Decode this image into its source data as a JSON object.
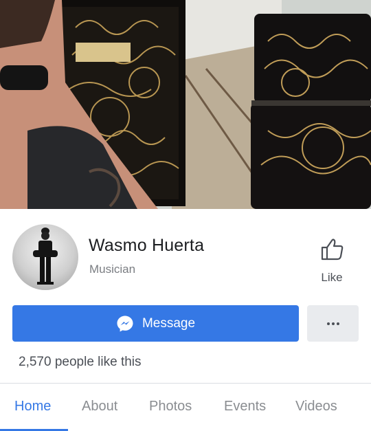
{
  "profile": {
    "name": "Wasmo Huerta",
    "category": "Musician",
    "likes_count_text": "2,570 people like this"
  },
  "actions": {
    "like_label": "Like",
    "message_label": "Message",
    "more_icon": "more-dots-icon"
  },
  "tabs": [
    {
      "label": "Home",
      "active": true
    },
    {
      "label": "About",
      "active": false
    },
    {
      "label": "Photos",
      "active": false
    },
    {
      "label": "Events",
      "active": false
    },
    {
      "label": "Videos",
      "active": false
    }
  ],
  "colors": {
    "primary": "#3578e5",
    "secondary_button_bg": "#e9ebee",
    "text_primary": "#1c1e21",
    "text_secondary": "#7a7d82",
    "tab_inactive": "#8a8d91"
  }
}
